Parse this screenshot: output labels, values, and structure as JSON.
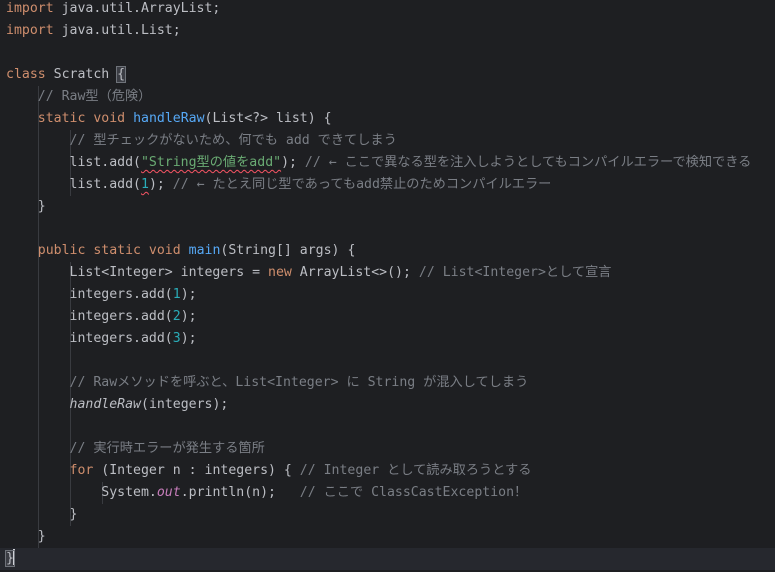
{
  "editor": {
    "language": "java",
    "theme_colors": {
      "background": "#1e1f22",
      "current_line": "#26282e",
      "text": "#bcbec4",
      "keyword": "#cf8e6d",
      "function": "#56a8f5",
      "string": "#6aab73",
      "number": "#2aacb8",
      "comment": "#7a7e85",
      "field": "#c77dbb",
      "error_underline": "#f75464"
    },
    "lines": [
      [
        {
          "t": "kw",
          "v": "import"
        },
        {
          "t": "pl",
          "v": " java.util.ArrayList;"
        }
      ],
      [
        {
          "t": "kw",
          "v": "import"
        },
        {
          "t": "pl",
          "v": " java.util.List;"
        }
      ],
      [],
      [
        {
          "t": "kw",
          "v": "class"
        },
        {
          "t": "pl",
          "v": " Scratch "
        },
        {
          "t": "br",
          "v": "{"
        }
      ],
      [
        {
          "t": "pl",
          "v": "    "
        },
        {
          "t": "cm",
          "v": "// Raw型（危険）"
        }
      ],
      [
        {
          "t": "pl",
          "v": "    "
        },
        {
          "t": "kw",
          "v": "static void"
        },
        {
          "t": "pl",
          "v": " "
        },
        {
          "t": "fn",
          "v": "handleRaw"
        },
        {
          "t": "pl",
          "v": "(List<?> list) {"
        }
      ],
      [
        {
          "t": "pl",
          "v": "        "
        },
        {
          "t": "cm",
          "v": "// 型チェックがないため、何でも add できてしまう"
        }
      ],
      [
        {
          "t": "pl",
          "v": "        list.add("
        },
        {
          "t": "str_warn",
          "v": "\"String型の値をadd\""
        },
        {
          "t": "pl",
          "v": "); "
        },
        {
          "t": "cm",
          "v": "// ← ここで異なる型を注入しようとしてもコンパイルエラーで検知できる"
        }
      ],
      [
        {
          "t": "pl",
          "v": "        list.add("
        },
        {
          "t": "num_warn",
          "v": "1"
        },
        {
          "t": "pl",
          "v": "); "
        },
        {
          "t": "cm",
          "v": "// ← たとえ同じ型であってもadd禁止のためコンパイルエラー"
        }
      ],
      [
        {
          "t": "pl",
          "v": "    }"
        }
      ],
      [],
      [
        {
          "t": "pl",
          "v": "    "
        },
        {
          "t": "kw",
          "v": "public static void"
        },
        {
          "t": "pl",
          "v": " "
        },
        {
          "t": "fn",
          "v": "main"
        },
        {
          "t": "pl",
          "v": "(String[] args) {"
        }
      ],
      [
        {
          "t": "pl",
          "v": "        List<Integer> integers = "
        },
        {
          "t": "kw",
          "v": "new"
        },
        {
          "t": "pl",
          "v": " ArrayList<>(); "
        },
        {
          "t": "cm",
          "v": "// List<Integer>として宣言"
        }
      ],
      [
        {
          "t": "pl",
          "v": "        integers.add("
        },
        {
          "t": "num",
          "v": "1"
        },
        {
          "t": "pl",
          "v": ");"
        }
      ],
      [
        {
          "t": "pl",
          "v": "        integers.add("
        },
        {
          "t": "num",
          "v": "2"
        },
        {
          "t": "pl",
          "v": ");"
        }
      ],
      [
        {
          "t": "pl",
          "v": "        integers.add("
        },
        {
          "t": "num",
          "v": "3"
        },
        {
          "t": "pl",
          "v": ");"
        }
      ],
      [],
      [
        {
          "t": "pl",
          "v": "        "
        },
        {
          "t": "cm",
          "v": "// Rawメソッドを呼ぶと、List<Integer> に String が混入してしまう"
        }
      ],
      [
        {
          "t": "pl",
          "v": "        "
        },
        {
          "t": "static",
          "v": "handleRaw"
        },
        {
          "t": "pl",
          "v": "(integers);"
        }
      ],
      [],
      [
        {
          "t": "pl",
          "v": "        "
        },
        {
          "t": "cm",
          "v": "// 実行時エラーが発生する箇所"
        }
      ],
      [
        {
          "t": "pl",
          "v": "        "
        },
        {
          "t": "kw",
          "v": "for"
        },
        {
          "t": "pl",
          "v": " (Integer n : integers) { "
        },
        {
          "t": "cm",
          "v": "// Integer として読み取ろうとする"
        }
      ],
      [
        {
          "t": "pl",
          "v": "            System."
        },
        {
          "t": "field",
          "v": "out"
        },
        {
          "t": "pl",
          "v": ".println(n);   "
        },
        {
          "t": "cm",
          "v": "// ここで ClassCastException！"
        }
      ],
      [
        {
          "t": "pl",
          "v": "        }"
        }
      ],
      [
        {
          "t": "pl",
          "v": "    }"
        }
      ],
      [
        {
          "t": "br",
          "v": "}"
        },
        {
          "t": "caret",
          "v": ""
        }
      ]
    ],
    "current_line_index": 25
  }
}
